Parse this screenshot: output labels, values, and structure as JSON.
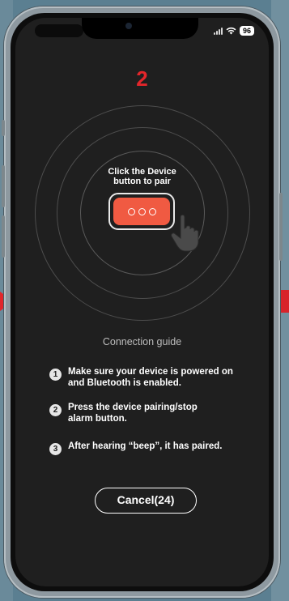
{
  "status_bar": {
    "battery": "96"
  },
  "step_number": "2",
  "pair_hint": {
    "line1": "Click the Device",
    "line2": "button to pair"
  },
  "guide": {
    "title": "Connection guide",
    "steps": [
      {
        "num": "1",
        "line1": "Make sure your device is powered on",
        "line2": "and Bluetooth is enabled."
      },
      {
        "num": "2",
        "line1": "Press the device pairing/stop",
        "line2": "alarm button."
      },
      {
        "num": "3",
        "line1": "After hearing “beep”, it has paired.",
        "line2": ""
      }
    ]
  },
  "cancel_button": {
    "label": "Cancel(24)"
  },
  "colors": {
    "accent": "#e3262b",
    "device_button": "#f05a42",
    "screen_bg": "#1f1f1f",
    "background": "#5b7f91"
  },
  "icons": [
    "signal-icon",
    "wifi-icon",
    "battery-icon",
    "device-dots-icon",
    "tap-hand-icon"
  ]
}
